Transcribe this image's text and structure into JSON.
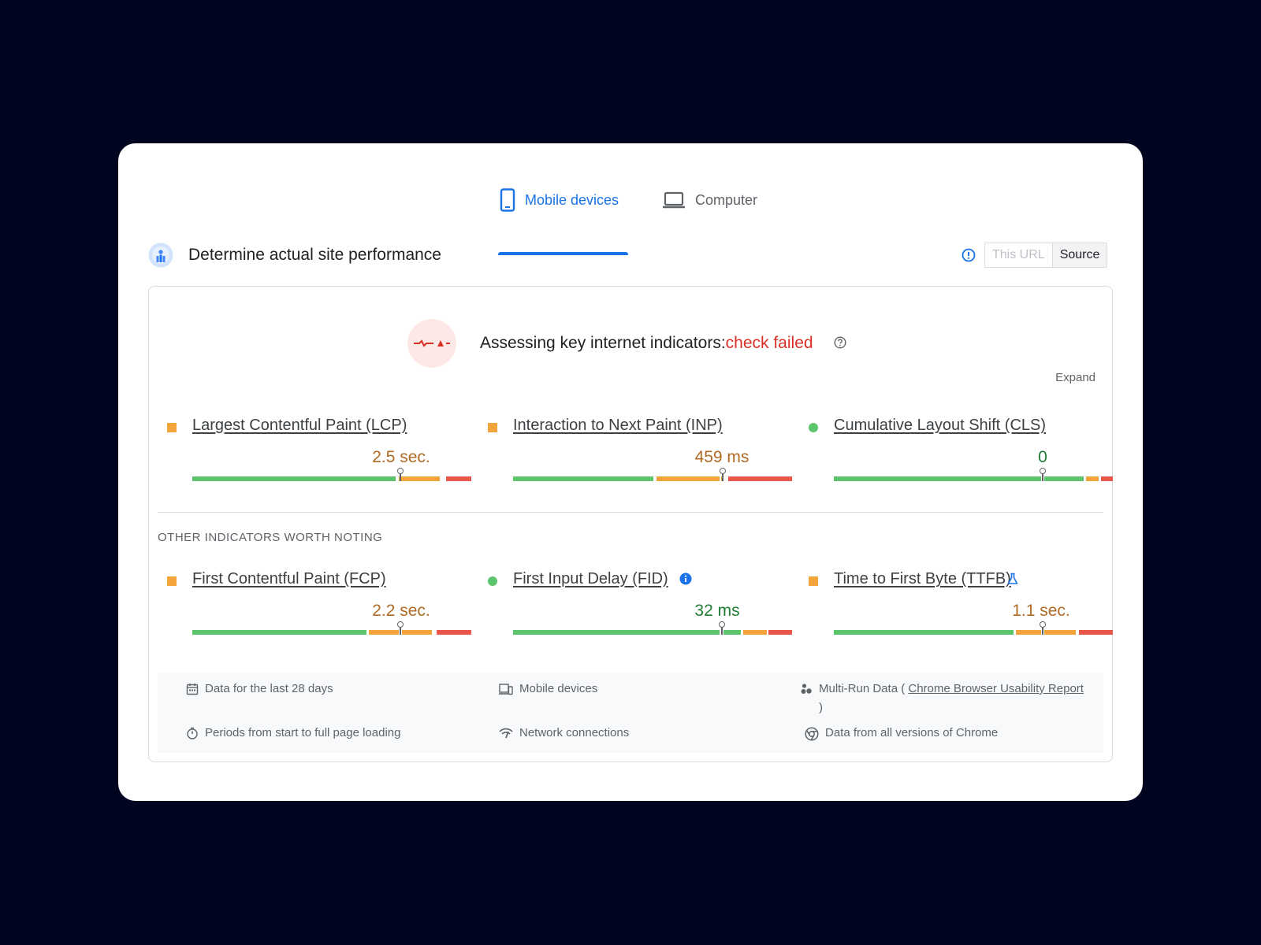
{
  "tabs": {
    "mobile": "Mobile devices",
    "computer": "Computer"
  },
  "header": {
    "title": "Determine actual site performance",
    "toggle_this_url": "This URL",
    "toggle_source": "Source"
  },
  "assessment": {
    "label": "Assessing key internet indicators:",
    "status": "check failed",
    "expand": "Expand"
  },
  "core_metrics": [
    {
      "name": "Largest Contentful Paint (LCP)",
      "value": "2.5 sec.",
      "status": "needs-improvement"
    },
    {
      "name": "Interaction to Next Paint (INP)",
      "value": "459 ms",
      "status": "needs-improvement"
    },
    {
      "name": "Cumulative Layout Shift (CLS)",
      "value": "0",
      "status": "good"
    }
  ],
  "other_title": "OTHER INDICATORS WORTH NOTING",
  "other_metrics": [
    {
      "name": "First Contentful Paint (FCP)",
      "value": "2.2 sec.",
      "status": "needs-improvement"
    },
    {
      "name": "First Input Delay (FID)",
      "value": "32 ms",
      "status": "good"
    },
    {
      "name": "Time to First Byte (TTFB)",
      "value": "1.1 sec.",
      "status": "needs-improvement"
    }
  ],
  "details": {
    "period": "Data for the last 28 days",
    "devices": "Mobile devices",
    "source_prefix": "Multi-Run Data ( ",
    "source_link": "Chrome Browser Usability Report",
    "source_suffix": " )",
    "loading": "Periods from start to full page loading",
    "network": "Network connections",
    "versions": "Data from all versions of Chrome"
  },
  "colors": {
    "accent": "#1a73e8",
    "good": "#5bc46c",
    "needs_improvement": "#f2a33a",
    "poor": "#e8574a",
    "fail_text": "#d93025"
  }
}
